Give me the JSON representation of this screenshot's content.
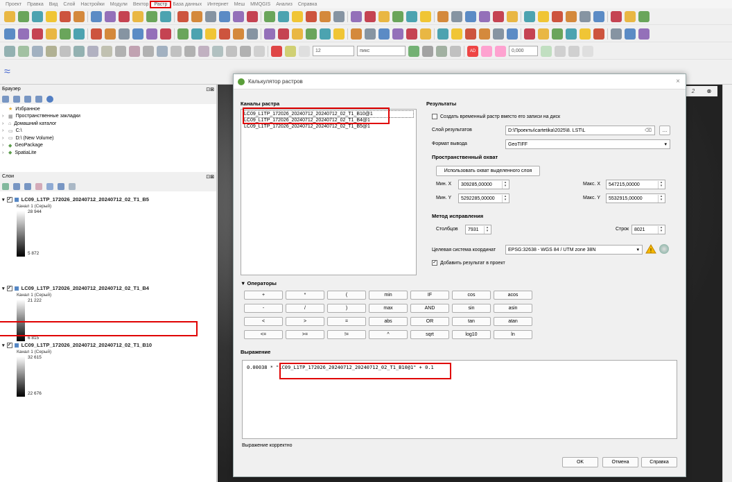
{
  "menu": [
    "Проект",
    "Правка",
    "Вид",
    "Слой",
    "Настройки",
    "Модули",
    "Вектор",
    "Растр",
    "База данных",
    "Интернет",
    "Меш",
    "MMQGIS",
    "Анализ",
    "Справка"
  ],
  "menu_highlight_index": 7,
  "toolbar": {
    "size_value": "12",
    "units": "пикс",
    "ad": "AD",
    "num_value": "0,000"
  },
  "browser": {
    "title": "Браузер",
    "items": [
      "Избранное",
      "Пространственные закладки",
      "Домашний каталог",
      "C:\\",
      "D:\\ (New Volume)",
      "GeoPackage",
      "SpatiaLite"
    ]
  },
  "layers": {
    "title": "Слои",
    "items": [
      {
        "name": "LC09_L1TP_172026_20240712_20240712_02_T1_B5",
        "band": "Канал 1 (Серый)",
        "max": "28 944",
        "min": "5 872"
      },
      {
        "name": "LC09_L1TP_172026_20240712_20240712_02_T1_B4",
        "band": "Канал 1 (Серый)",
        "max": "21 222",
        "min": "6 815"
      },
      {
        "name": "LC09_L1TP_172026_20240712_20240712_02_T1_B10",
        "band": "Канал 1 (Серый)",
        "max": "32 615",
        "min": "22 676"
      }
    ]
  },
  "dialog": {
    "title": "Калькулятор растров",
    "bands_title": "Каналы растра",
    "bands": [
      "LC09_L1TP_172026_20240712_20240712_02_T1_B10@1",
      "LC09_L1TP_172026_20240712_20240712_02_T1_B4@1",
      "LC09_L1TP_172026_20240712_20240712_02_T1_B5@1"
    ],
    "results_title": "Результаты",
    "temp_raster": "Создать временный растр вместо его записи на диск",
    "output_layer_label": "Слой результатов",
    "output_layer_value": "D:\\Проекты\\cartetika\\2025\\8. LST\\L",
    "format_label": "Формат вывода",
    "format_value": "GeoTIFF",
    "extent_title": "Пространственный охват",
    "use_selected": "Использовать охват выделенного слоя",
    "minx_label": "Мин. X",
    "minx": "309285,00000",
    "maxx_label": "Макс. X",
    "maxx": "547215,00000",
    "miny_label": "Мин. Y",
    "miny": "5292285,00000",
    "maxy_label": "Макс. Y",
    "maxy": "5532915,00000",
    "resolution_title": "Метод исправления",
    "columns_label": "Столбцов",
    "columns": "7931",
    "rows_label": "Строк",
    "rows": "8021",
    "crs_label": "Целевая система координат",
    "crs_value": "EPSG:32638 - WGS 84 / UTM zone 38N",
    "add_result": "Добавить результат в проект",
    "operators_title": "Операторы",
    "operators": [
      [
        "+",
        "*",
        "(",
        "min",
        "IF",
        "cos",
        "acos"
      ],
      [
        "-",
        "/",
        ")",
        "max",
        "AND",
        "sin",
        "asin"
      ],
      [
        "<",
        ">",
        "=",
        "abs",
        "OR",
        "tan",
        "atan"
      ],
      [
        "<=",
        ">=",
        "!=",
        "^",
        "sqrt",
        "log10",
        "ln"
      ]
    ],
    "expression_title": "Выражение",
    "expr_prefix": "0.00038 * ",
    "expr_band": "\"LC09_L1TP_172026_20240712_20240712_02_T1_B10@1\"",
    "expr_suffix": " + 0.1",
    "status": "Выражение корректно",
    "ok": "OK",
    "cancel": "Отмена",
    "help": "Справка"
  },
  "map_tab_number": "2"
}
